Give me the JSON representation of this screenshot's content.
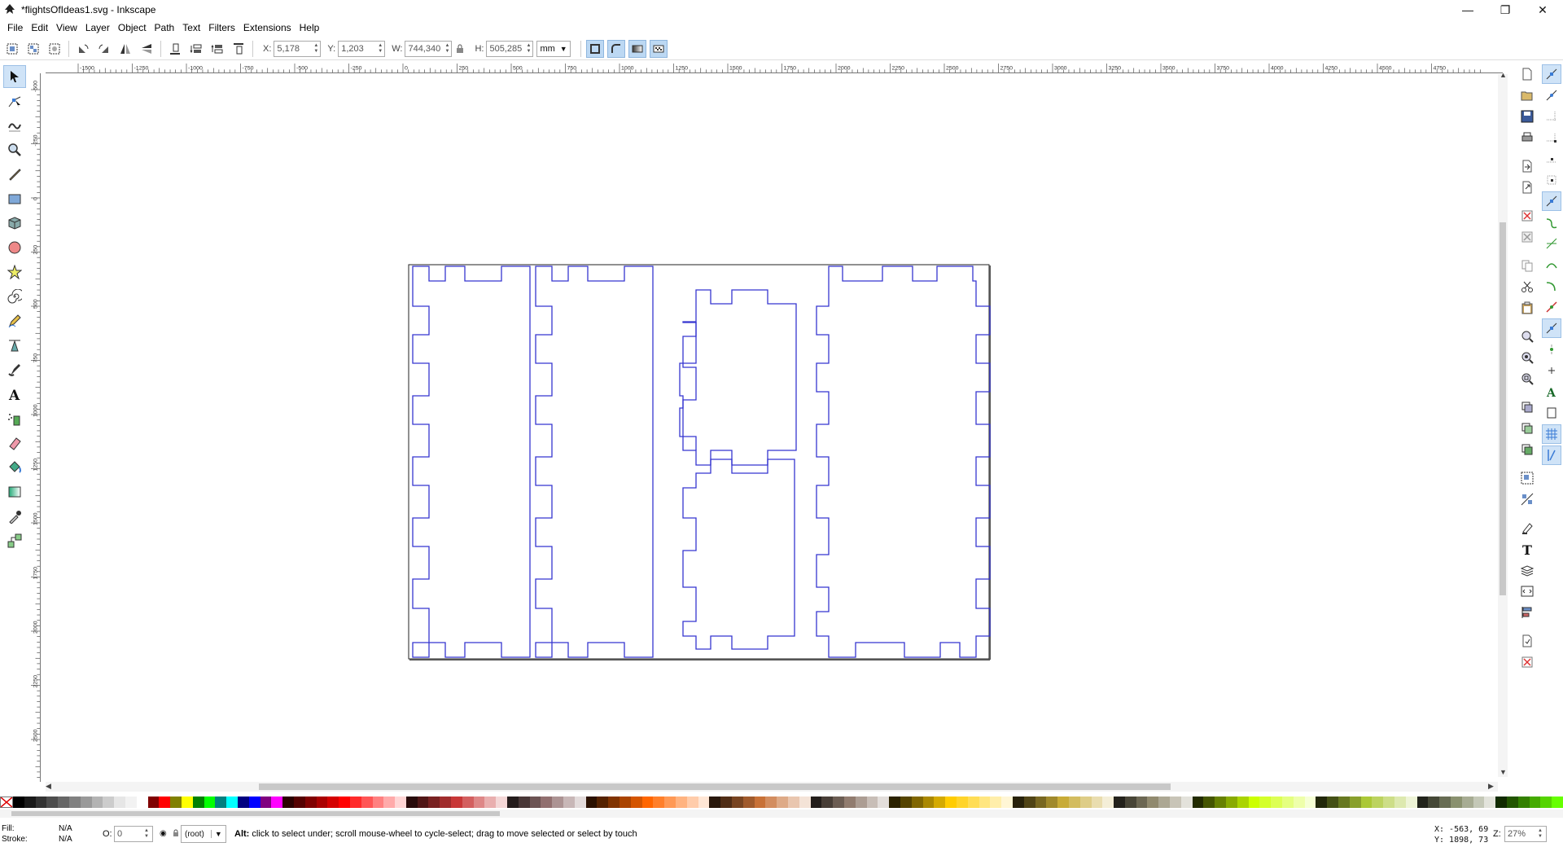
{
  "window": {
    "title": "*flightsOfIdeas1.svg - Inkscape",
    "minimize": "—",
    "maximize": "❐",
    "close": "✕"
  },
  "menu": [
    {
      "label": "File"
    },
    {
      "label": "Edit"
    },
    {
      "label": "View"
    },
    {
      "label": "Layer"
    },
    {
      "label": "Object"
    },
    {
      "label": "Path"
    },
    {
      "label": "Text"
    },
    {
      "label": "Filters"
    },
    {
      "label": "Extensions"
    },
    {
      "label": "Help"
    }
  ],
  "toolcontrols": {
    "x_label": "X:",
    "x_value": "5,178",
    "y_label": "Y:",
    "y_value": "1,203",
    "w_label": "W:",
    "w_value": "744,340",
    "h_label": "H:",
    "h_value": "505,285",
    "unit": "mm"
  },
  "ruler": {
    "h_labels": [
      "-1500",
      "-1250",
      "-1000",
      "-750",
      "-500",
      "-250",
      "0",
      "250",
      "500",
      "750",
      "1000",
      "1250",
      "1500",
      "1750",
      "2000",
      "2250",
      "2500",
      "2750",
      "3000",
      "3250",
      "3500",
      "3750",
      "4000",
      "4250",
      "4500",
      "4750"
    ],
    "v_labels": [
      "-500",
      "-250",
      "0",
      "250",
      "500",
      "750",
      "1000",
      "1250",
      "1500",
      "1750",
      "2000",
      "2250",
      "2500"
    ]
  },
  "palette": {
    "colors": [
      "#000000",
      "#1a1a1a",
      "#333333",
      "#4d4d4d",
      "#666666",
      "#808080",
      "#999999",
      "#b3b3b3",
      "#cccccc",
      "#e6e6e6",
      "#f2f2f2",
      "#ffffff",
      "#800000",
      "#ff0000",
      "#808000",
      "#ffff00",
      "#008000",
      "#00ff00",
      "#008080",
      "#00ffff",
      "#000080",
      "#0000ff",
      "#800080",
      "#ff00ff",
      "#2b0000",
      "#550000",
      "#800000",
      "#aa0000",
      "#d40000",
      "#ff0000",
      "#ff2a2a",
      "#ff5555",
      "#ff8080",
      "#ffaaaa",
      "#ffd5d5",
      "#280b0b",
      "#501616",
      "#782121",
      "#a02c2c",
      "#c83737",
      "#d35f5f",
      "#de8787",
      "#e9afaf",
      "#f4d7d7",
      "#241c1c",
      "#483737",
      "#6c5353",
      "#916f6f",
      "#ac9393",
      "#c8b7b7",
      "#e3dbdb",
      "#2b1100",
      "#552200",
      "#803300",
      "#aa4400",
      "#d45500",
      "#ff6600",
      "#ff7f2a",
      "#ff9955",
      "#ffb380",
      "#ffccaa",
      "#ffe6d5",
      "#28170b",
      "#502d16",
      "#784421",
      "#a05a2c",
      "#c87137",
      "#d38d5f",
      "#deaa87",
      "#e9c6af",
      "#f4e3d7",
      "#241f1c",
      "#483e37",
      "#6c5d53",
      "#917c6f",
      "#ac9d93",
      "#c8beb7",
      "#e3dedb",
      "#2b2200",
      "#554400",
      "#806600",
      "#aa8800",
      "#d4aa00",
      "#ffcc00",
      "#ffd42a",
      "#ffdd55",
      "#ffe680",
      "#ffeeaa",
      "#fff6d5",
      "#28220b",
      "#504416",
      "#786721",
      "#a0892c",
      "#c8ab37",
      "#d3bc5f",
      "#decd87",
      "#e9ddaf",
      "#f4eed7",
      "#24221c",
      "#484537",
      "#6c6753",
      "#918a6f",
      "#aca793",
      "#c8c4b7",
      "#e3e2db",
      "#222b00",
      "#445500",
      "#668000",
      "#88aa00",
      "#aad400",
      "#ccff00",
      "#d4ff2a",
      "#ddff55",
      "#e5ff80",
      "#eeffaa",
      "#f6ffd5",
      "#22280b",
      "#445016",
      "#677821",
      "#89a02c",
      "#abc837",
      "#bcd35f",
      "#cdde87",
      "#dde9af",
      "#eef4d7",
      "#22241c",
      "#454837",
      "#676c53",
      "#8a916f",
      "#a7ac93",
      "#c4c8b7",
      "#e2e3db",
      "#112b00",
      "#225500",
      "#338000",
      "#44aa00",
      "#55d400",
      "#66ff00"
    ]
  },
  "status": {
    "fill_label": "Fill:",
    "fill_value": "N/A",
    "stroke_label": "Stroke:",
    "stroke_value": "N/A",
    "opacity_label": "O:",
    "opacity_value": "0",
    "layer": "(root)",
    "message_bold": "Alt:",
    "message": " click to select under; scroll mouse-wheel to cycle-select; drag to move selected or select by touch",
    "x_coord": "X: -563, 69",
    "y_coord": "Y: 1898, 73",
    "zoom_label": "Z:",
    "zoom_value": "27%"
  }
}
